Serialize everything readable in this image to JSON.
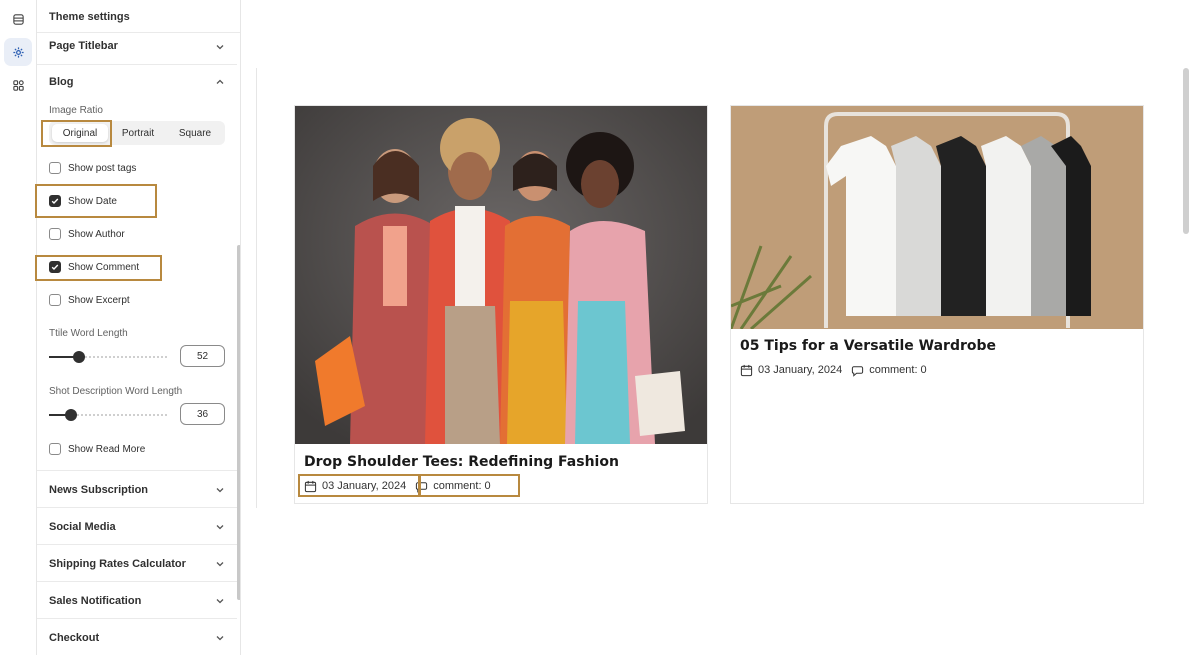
{
  "rail": {
    "icons": [
      "sections-icon",
      "gear-icon",
      "apps-icon"
    ],
    "active": "gear-icon"
  },
  "panel": {
    "title": "Theme settings",
    "sections_top": [
      {
        "label": "Page Titlebar",
        "expanded": false
      }
    ],
    "blog": {
      "label": "Blog",
      "expanded": true,
      "image_ratio": {
        "label": "Image Ratio",
        "options": [
          "Original",
          "Portrait",
          "Square"
        ],
        "selected": "Original"
      },
      "checks": [
        {
          "label": "Show post tags",
          "checked": false
        },
        {
          "label": "Show Date",
          "checked": true
        },
        {
          "label": "Show Author",
          "checked": false
        },
        {
          "label": "Show Comment",
          "checked": true
        },
        {
          "label": "Show Excerpt",
          "checked": false
        }
      ],
      "title_word_length": {
        "label": "Ttile Word Length",
        "value": "52",
        "fraction": 0.25
      },
      "short_desc_length": {
        "label": "Shot Description Word Length",
        "value": "36",
        "fraction": 0.19
      },
      "show_read_more": {
        "label": "Show Read More",
        "checked": false
      }
    },
    "sections_bottom": [
      {
        "label": "News Subscription"
      },
      {
        "label": "Social Media"
      },
      {
        "label": "Shipping Rates Calculator"
      },
      {
        "label": "Sales Notification"
      },
      {
        "label": "Checkout"
      }
    ]
  },
  "preview": {
    "posts": [
      {
        "title": "Drop Shoulder Tees: Redefining Fashion",
        "date": "03 January, 2024",
        "comments": "comment: 0"
      },
      {
        "title": "05 Tips for a Versatile Wardrobe",
        "date": "03 January, 2024",
        "comments": "comment: 0"
      }
    ]
  },
  "colors": {
    "highlight": "#b8893f",
    "text": "#303030",
    "active_rail": "#e9eef7"
  }
}
